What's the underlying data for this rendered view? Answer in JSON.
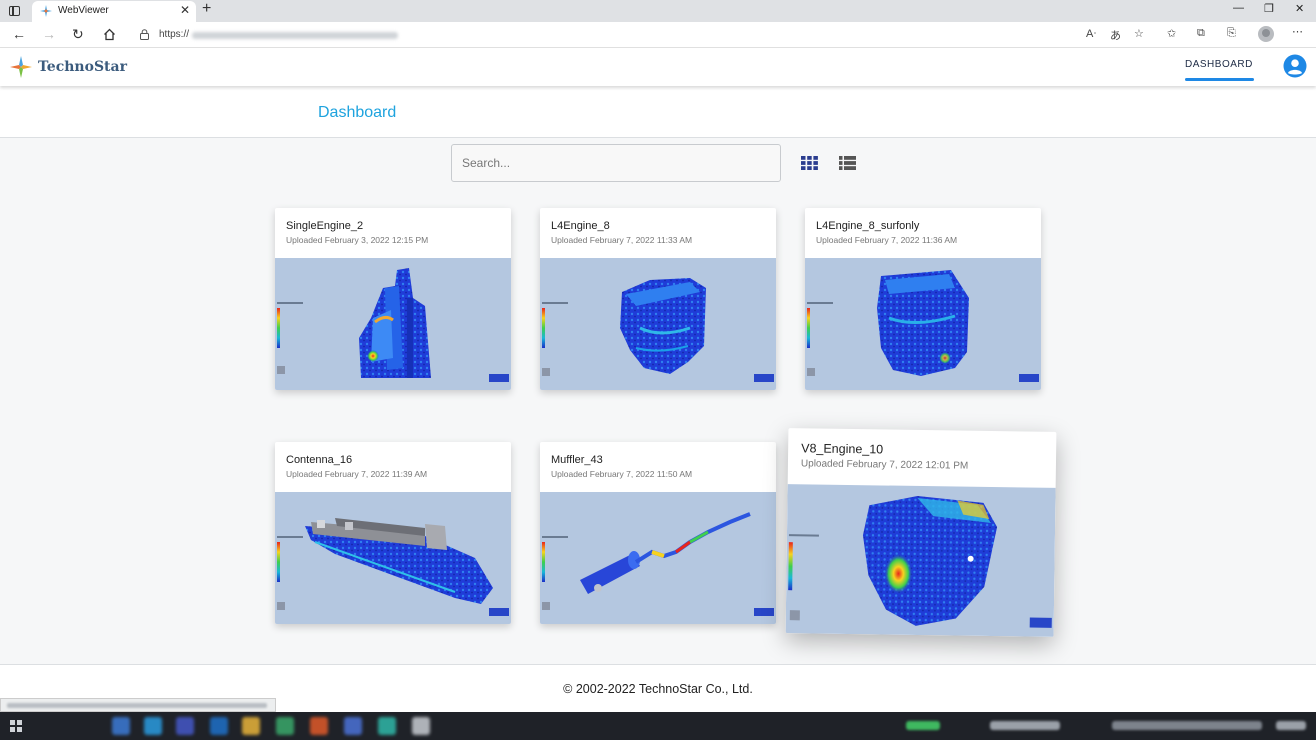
{
  "browser": {
    "tab_title": "WebViewer",
    "url_prefix": "https://",
    "new_tab_glyph": "+",
    "close_glyph": "✕",
    "nav_icons": [
      "back-arrow-icon",
      "forward-arrow-icon",
      "refresh-icon",
      "home-icon"
    ],
    "toolbar_icons": [
      "read-aloud-icon",
      "translate-icon",
      "add-favorite-icon",
      "favorites-icon",
      "collections-icon",
      "browser-essentials-icon",
      "profile-icon",
      "more-menu-icon"
    ]
  },
  "header": {
    "brand": "TechnoStar",
    "nav_dashboard": "DASHBOARD",
    "accent": "#1e88e5"
  },
  "page": {
    "title": "Dashboard",
    "title_color": "#1ea3de"
  },
  "search": {
    "placeholder": "Search..."
  },
  "view_toggle": {
    "grid_icon": "grid-view-icon",
    "list_icon": "list-view-icon",
    "active": "grid",
    "color": "#2b3d8f"
  },
  "models": [
    {
      "name": "SingleEngine_2",
      "uploaded": "Uploaded February 3, 2022 12:15 PM"
    },
    {
      "name": "L4Engine_8",
      "uploaded": "Uploaded February 7, 2022 11:33 AM"
    },
    {
      "name": "L4Engine_8_surfonly",
      "uploaded": "Uploaded February 7, 2022 11:36 AM"
    },
    {
      "name": "Contenna_16",
      "uploaded": "Uploaded February 7, 2022 11:39 AM"
    },
    {
      "name": "Muffler_43",
      "uploaded": "Uploaded February 7, 2022 11:50 AM"
    },
    {
      "name": "V8_Engine_10",
      "uploaded": "Uploaded February 7, 2022 12:01 PM"
    }
  ],
  "thumbnail_bg": "#b4c7e0",
  "footer": {
    "copyright": "© 2002-2022 TechnoStar Co., Ltd."
  }
}
